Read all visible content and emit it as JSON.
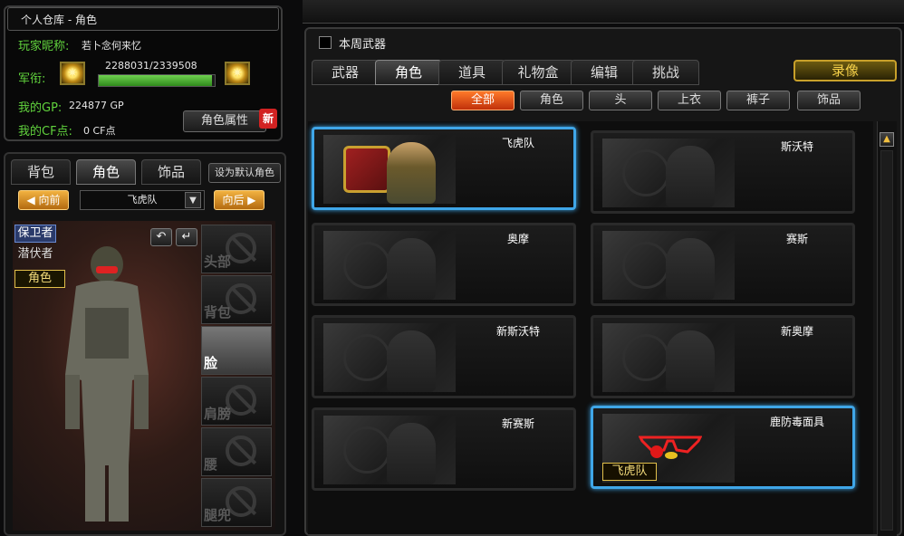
{
  "left": {
    "window_title": "个人仓库 - 角色",
    "nickname_label": "玩家昵称:",
    "nickname_value": "若卜念何来忆",
    "rank_label": "军衔:",
    "xp_text": "2288031/2339508",
    "xp_progress": 0.978,
    "gp_label": "我的GP:",
    "gp_value": "224877 GP",
    "cf_label": "我的CF点:",
    "cf_value": "0 CF点",
    "attr_button": "角色属性",
    "new_badge": "新"
  },
  "char_panel": {
    "tabs": [
      "背包",
      "角色",
      "饰品"
    ],
    "active_tab": 1,
    "set_default": "设为默认角色",
    "prev": "◀ 向前",
    "next": "向后 ▶",
    "selected_char": "飞虎队",
    "modes": [
      "保卫者",
      "潜伏者",
      "角色"
    ],
    "slots": [
      "头部",
      "背包",
      "脸",
      "肩膀",
      "腰",
      "腿兜"
    ],
    "active_slot": 2
  },
  "right": {
    "title": "本周武器",
    "tabs": [
      "武器",
      "角色",
      "道具",
      "礼物盒",
      "编辑",
      "挑战"
    ],
    "active_tab": 1,
    "record_button": "录像",
    "filters": [
      "全部",
      "角色",
      "头",
      "上衣",
      "裤子",
      "饰品"
    ],
    "active_filter": 0,
    "items": [
      {
        "name": "飞虎队",
        "selected": true
      },
      {
        "name": "斯沃特",
        "selected": false
      },
      {
        "name": "奥摩",
        "selected": false
      },
      {
        "name": "赛斯",
        "selected": false
      },
      {
        "name": "新斯沃特",
        "selected": false
      },
      {
        "name": "新奥摩",
        "selected": false
      },
      {
        "name": "新赛斯",
        "selected": false
      },
      {
        "name": "鹿防毒面具",
        "selected": true,
        "badge": "飞虎队"
      }
    ]
  },
  "colors": {
    "green_text": "#61d33d",
    "selected_border": "#3fa6e8",
    "active_filter": "#e04410",
    "gold": "#f2c040"
  }
}
